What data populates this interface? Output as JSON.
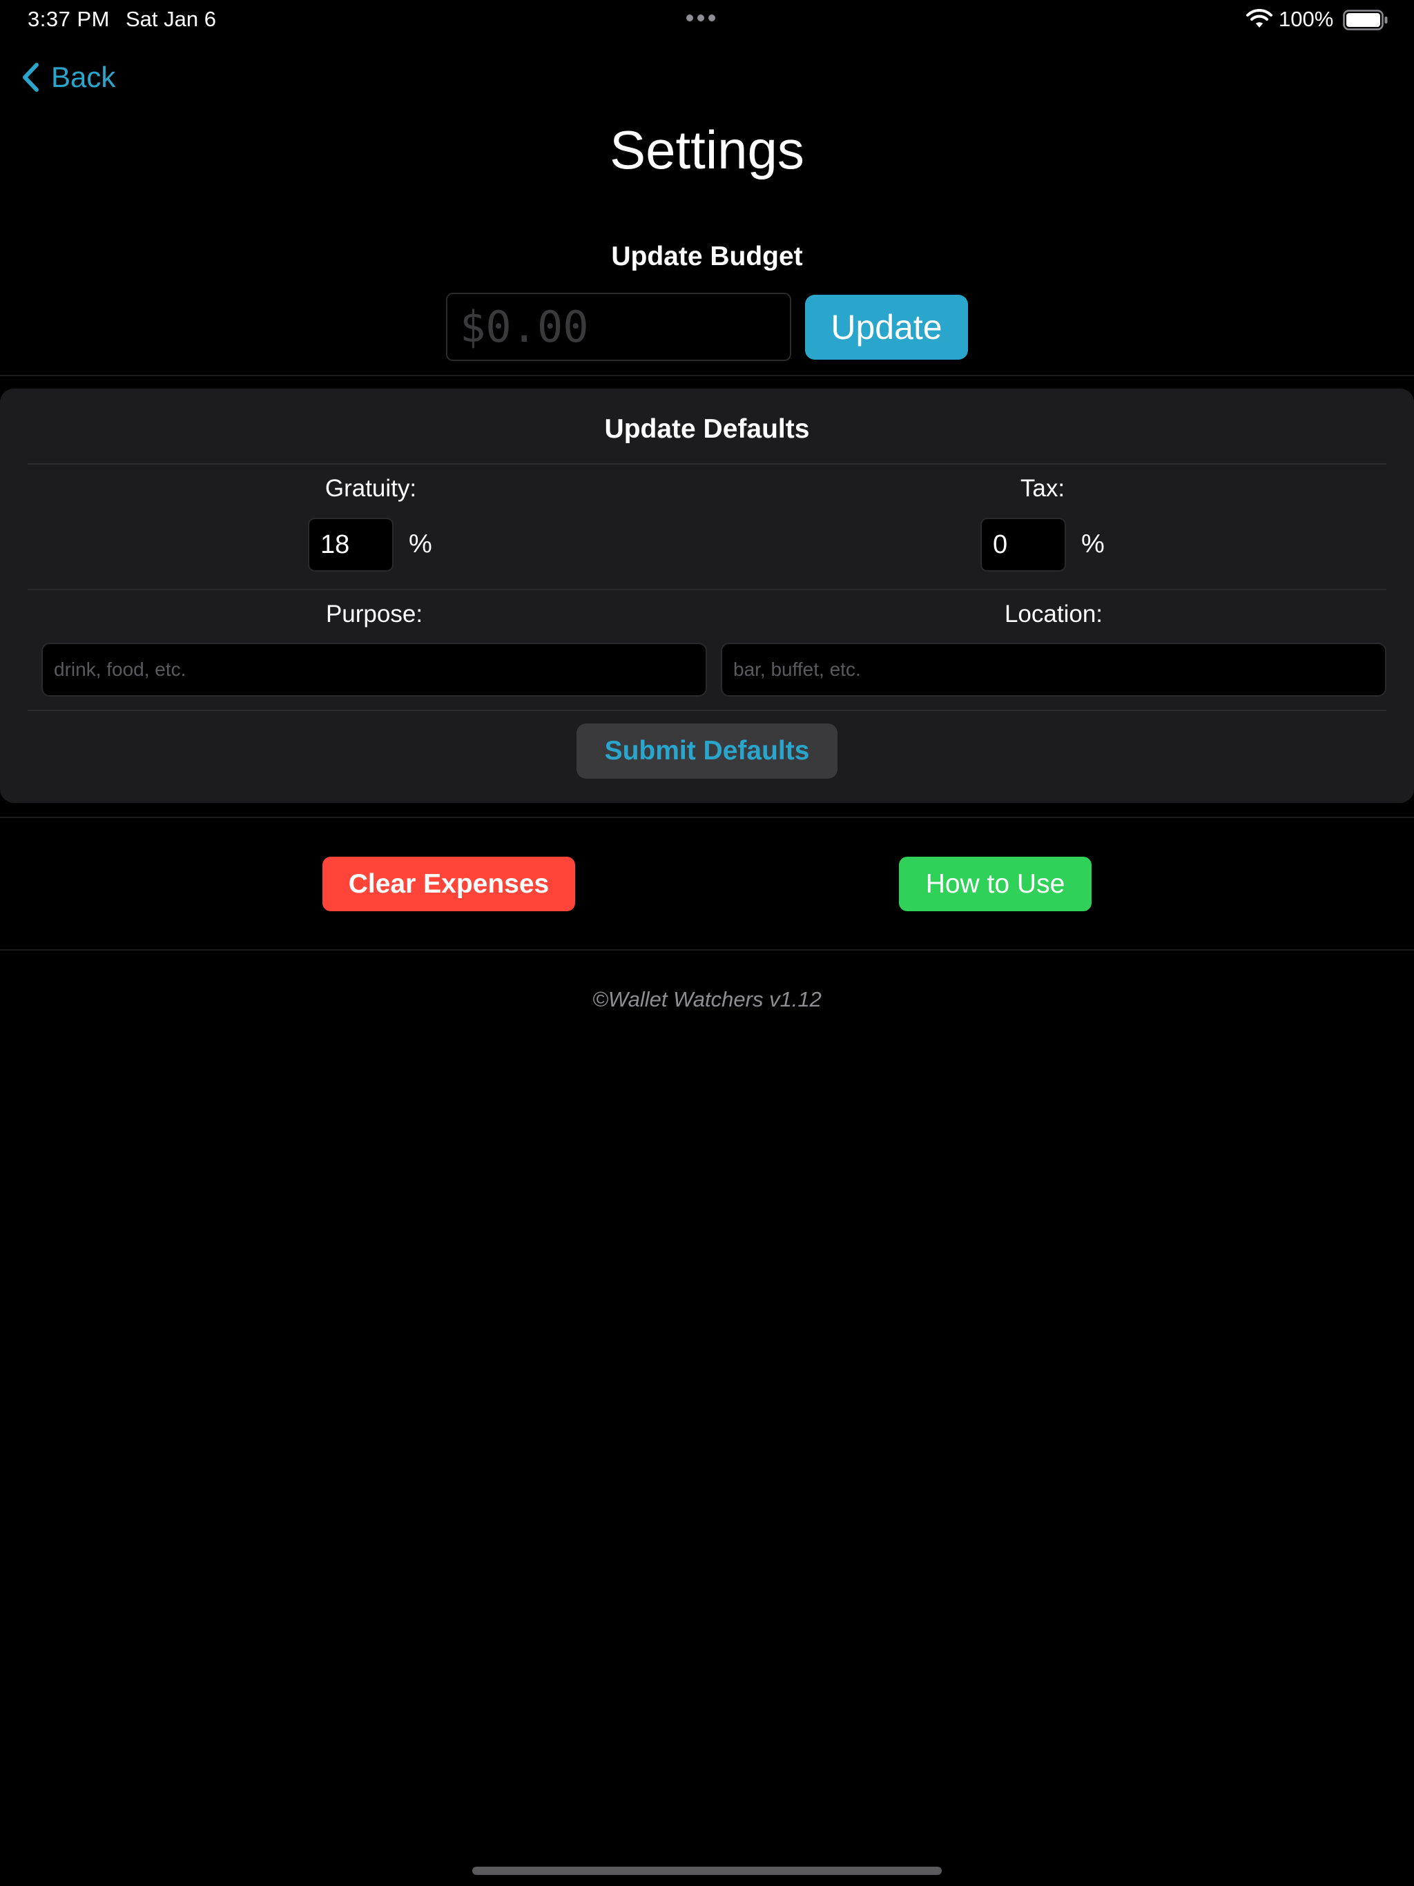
{
  "status_bar": {
    "time": "3:37 PM",
    "date": "Sat Jan 6",
    "battery": "100%",
    "icons": [
      "wifi-icon",
      "battery-icon",
      "multitask-dots-icon"
    ]
  },
  "nav": {
    "back_label": "Back",
    "back_icon": "chevron-left-icon",
    "title": "Settings"
  },
  "budget": {
    "heading": "Update Budget",
    "placeholder": "$0.00",
    "value": "",
    "button_label": "Update"
  },
  "defaults": {
    "heading": "Update Defaults",
    "gratuity_label": "Gratuity:",
    "gratuity_value": "18",
    "tax_label": "Tax:",
    "tax_value": "0",
    "percent_sign": "%",
    "purpose_label": "Purpose:",
    "purpose_placeholder": "drink, food, etc.",
    "location_label": "Location:",
    "location_placeholder": "bar, buffet, etc.",
    "submit_label": "Submit Defaults"
  },
  "actions": {
    "clear_label": "Clear Expenses",
    "howto_label": "How to Use"
  },
  "footer": {
    "version": "©Wallet Watchers v1.12"
  },
  "colors": {
    "accent": "#2aa6cc",
    "danger": "#ff453a",
    "success": "#30d158",
    "card": "#1c1c1e",
    "background": "#000000"
  }
}
